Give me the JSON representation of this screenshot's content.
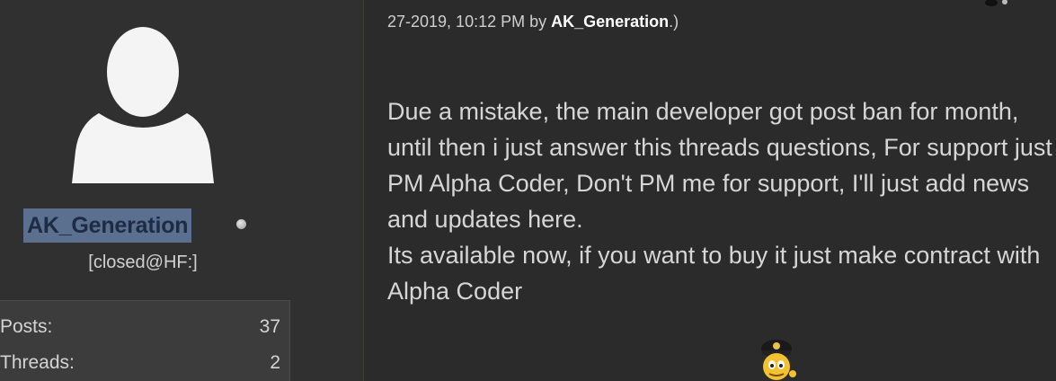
{
  "user_panel": {
    "username": "AK_Generation",
    "usertitle": "[closed@HF:]",
    "stats": [
      {
        "label": "Posts:",
        "value": "37"
      },
      {
        "label": "Threads:",
        "value": "2"
      }
    ],
    "avatar_icon": "default-avatar-silhouette",
    "status_icon": "offline-status-dot"
  },
  "post": {
    "edit_note_prefix": "27-2019, 10:12 PM by ",
    "edit_note_editor": "AK_Generation",
    "edit_note_suffix": ".)",
    "paragraph_1": "Due a mistake, the main developer got post ban for month, until then i just answer this threads questions, For support just PM Alpha Coder, Don't PM me for support, I'll just add news and updates here.",
    "paragraph_2": "Its available now, if you want to buy it just make contract with Alpha Coder",
    "smiley_icon": "police-smiley-icon"
  },
  "colors": {
    "background": "#2b2b2b",
    "panel": "#303030",
    "username_highlight": "#5b6f8e",
    "text": "#d6d6d6"
  }
}
